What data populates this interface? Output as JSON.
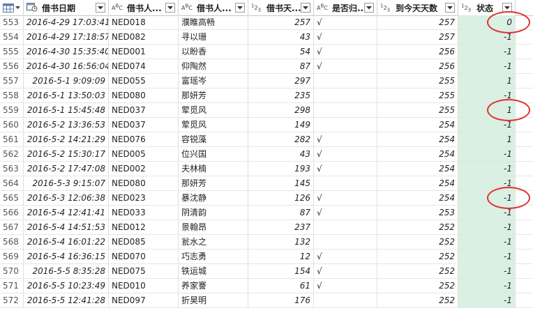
{
  "accent_status_bg": "#d9f0e3",
  "annotation_color": "#e03030",
  "header": {
    "corner_icon": "table-grid-icon",
    "columns": [
      {
        "key": "date",
        "type_icon": "datetime-type-icon",
        "type_label": "",
        "label": "借书日期"
      },
      {
        "key": "id",
        "type_icon": "text-type-icon",
        "type_label": "ABC",
        "label": "借书人..."
      },
      {
        "key": "name",
        "type_icon": "text-type-icon",
        "type_label": "ABC",
        "label": "借书人..."
      },
      {
        "key": "days",
        "type_icon": "number-type-icon",
        "type_label": "123",
        "label": "借书天..."
      },
      {
        "key": "returned",
        "type_icon": "text-type-icon",
        "type_label": "ABC",
        "label": "是否归..."
      },
      {
        "key": "today",
        "type_icon": "number-type-icon",
        "type_label": "123",
        "label": "到今天天数"
      },
      {
        "key": "status",
        "type_icon": "number-type-icon",
        "type_label": "123",
        "label": "状态"
      }
    ]
  },
  "rows": [
    {
      "n": "553",
      "date": "2016-4-29 17:03:41",
      "id": "NED018",
      "name": "濮睢高畅",
      "days": "257",
      "returned": "√",
      "today": "257",
      "status": "0"
    },
    {
      "n": "554",
      "date": "2016-4-29 17:18:57",
      "id": "NED082",
      "name": "寻以珊",
      "days": "43",
      "returned": "√",
      "today": "257",
      "status": "-1"
    },
    {
      "n": "555",
      "date": "2016-4-30 15:35:40",
      "id": "NED001",
      "name": "以盼香",
      "days": "54",
      "returned": "√",
      "today": "256",
      "status": "-1"
    },
    {
      "n": "556",
      "date": "2016-4-30 16:56:04",
      "id": "NED074",
      "name": "仰陶然",
      "days": "87",
      "returned": "√",
      "today": "256",
      "status": "-1"
    },
    {
      "n": "557",
      "date": "2016-5-1 9:09:09",
      "id": "NED055",
      "name": "富瑶岑",
      "days": "297",
      "returned": "",
      "today": "255",
      "status": "1"
    },
    {
      "n": "558",
      "date": "2016-5-1 13:50:03",
      "id": "NED080",
      "name": "那妍芳",
      "days": "235",
      "returned": "",
      "today": "255",
      "status": "-1"
    },
    {
      "n": "559",
      "date": "2016-5-1 15:45:48",
      "id": "NED037",
      "name": "荤觅风",
      "days": "298",
      "returned": "",
      "today": "255",
      "status": "1"
    },
    {
      "n": "560",
      "date": "2016-5-2 13:36:53",
      "id": "NED037",
      "name": "荤觅风",
      "days": "149",
      "returned": "",
      "today": "254",
      "status": "-1"
    },
    {
      "n": "561",
      "date": "2016-5-2 14:21:29",
      "id": "NED076",
      "name": "容锐藻",
      "days": "282",
      "returned": "√",
      "today": "254",
      "status": "1"
    },
    {
      "n": "562",
      "date": "2016-5-2 15:30:17",
      "id": "NED005",
      "name": "位兴国",
      "days": "43",
      "returned": "√",
      "today": "254",
      "status": "-1"
    },
    {
      "n": "563",
      "date": "2016-5-2 17:47:08",
      "id": "NED002",
      "name": "夫林楠",
      "days": "193",
      "returned": "√",
      "today": "254",
      "status": "-1"
    },
    {
      "n": "564",
      "date": "2016-5-3 9:15:07",
      "id": "NED080",
      "name": "那妍芳",
      "days": "145",
      "returned": "",
      "today": "254",
      "status": "-1"
    },
    {
      "n": "565",
      "date": "2016-5-3 12:06:38",
      "id": "NED023",
      "name": "暴沈静",
      "days": "126",
      "returned": "√",
      "today": "254",
      "status": "-1"
    },
    {
      "n": "566",
      "date": "2016-5-4 12:41:41",
      "id": "NED033",
      "name": "阴清韵",
      "days": "87",
      "returned": "√",
      "today": "253",
      "status": "-1"
    },
    {
      "n": "567",
      "date": "2016-5-4 14:51:53",
      "id": "NED012",
      "name": "景翰昂",
      "days": "237",
      "returned": "",
      "today": "252",
      "status": "-1"
    },
    {
      "n": "568",
      "date": "2016-5-4 16:01:22",
      "id": "NED085",
      "name": "瓮水之",
      "days": "132",
      "returned": "",
      "today": "252",
      "status": "-1"
    },
    {
      "n": "569",
      "date": "2016-5-4 16:36:15",
      "id": "NED070",
      "name": "巧志勇",
      "days": "12",
      "returned": "√",
      "today": "252",
      "status": "-1"
    },
    {
      "n": "570",
      "date": "2016-5-5 8:35:28",
      "id": "NED075",
      "name": "铁运城",
      "days": "154",
      "returned": "√",
      "today": "252",
      "status": "-1"
    },
    {
      "n": "571",
      "date": "2016-5-5 10:23:49",
      "id": "NED010",
      "name": "养家謇",
      "days": "61",
      "returned": "√",
      "today": "252",
      "status": "-1"
    },
    {
      "n": "572",
      "date": "2016-5-5 12:41:28",
      "id": "NED097",
      "name": "折昊明",
      "days": "176",
      "returned": "",
      "today": "252",
      "status": "-1"
    }
  ]
}
